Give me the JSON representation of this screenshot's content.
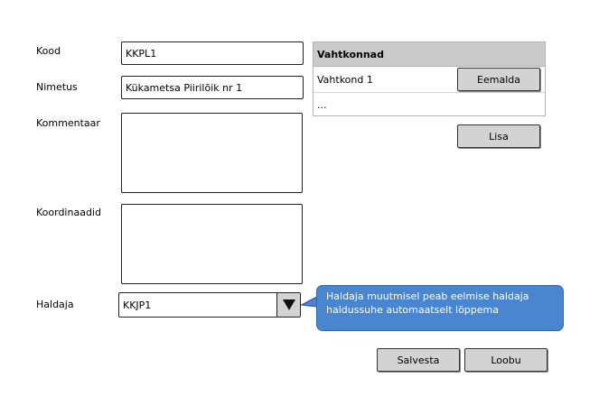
{
  "form": {
    "kood_label": "Kood",
    "kood_value": "KKPL1",
    "nimetus_label": "Nimetus",
    "nimetus_value": "Kükametsa Piirilõik nr 1",
    "kommentaar_label": "Kommentaar",
    "koordinaadid_label": "Koordinaadid",
    "haldaja_label": "Haldaja",
    "haldaja_value": "KKJP1"
  },
  "vahtkonnad": {
    "header": "Vahtkonnad",
    "rows": [
      "Vahtkond 1",
      "..."
    ],
    "remove_label": "Eemalda",
    "add_label": "Lisa"
  },
  "tooltip": {
    "line1": "Haldaja muutmisel peab eelmise haldaja",
    "line2": "haldussuhe automaatselt lõppema"
  },
  "actions": {
    "save_label": "Salvesta",
    "cancel_label": "Loobu"
  },
  "icons": {
    "dropdown": "triangle-down-icon"
  }
}
